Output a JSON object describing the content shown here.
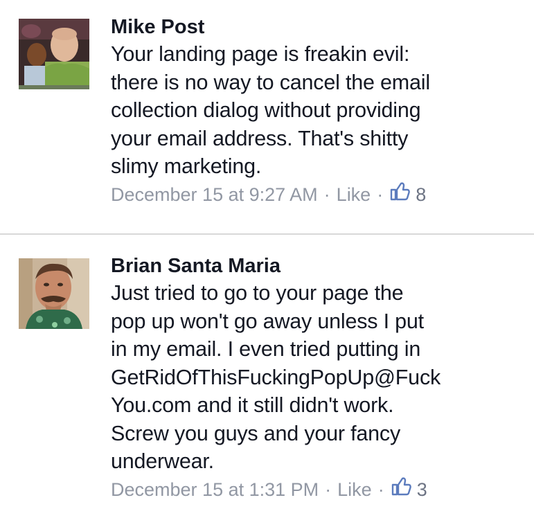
{
  "comments": [
    {
      "author": "Mike Post",
      "lines": [
        "Your landing page is freakin evil:",
        "there is no way to cancel the email",
        "collection dialog without providing",
        "your email address.  That's shitty",
        "slimy marketing."
      ],
      "timestamp": "December 15 at 9:27 AM",
      "separator": "·",
      "like_label": "Like",
      "like_count": "8",
      "like_icon": "thumbs-up-icon"
    },
    {
      "author": "Brian Santa Maria",
      "lines": [
        "Just tried to go to your page the",
        "pop up won't go away unless I put",
        "in my email. I even tried putting in",
        "GetRidOfThisFuckingPopUp@Fuck",
        "You.com and it still didn't work.",
        "Screw you guys and your fancy",
        "underwear."
      ],
      "timestamp": "December 15 at 1:31 PM",
      "separator": "·",
      "like_label": "Like",
      "like_count": "3",
      "like_icon": "thumbs-up-icon"
    }
  ],
  "colors": {
    "text": "#141823",
    "meta": "#9197a3",
    "like_icon": "#5b7bbd",
    "divider": "#d8d8d8"
  }
}
